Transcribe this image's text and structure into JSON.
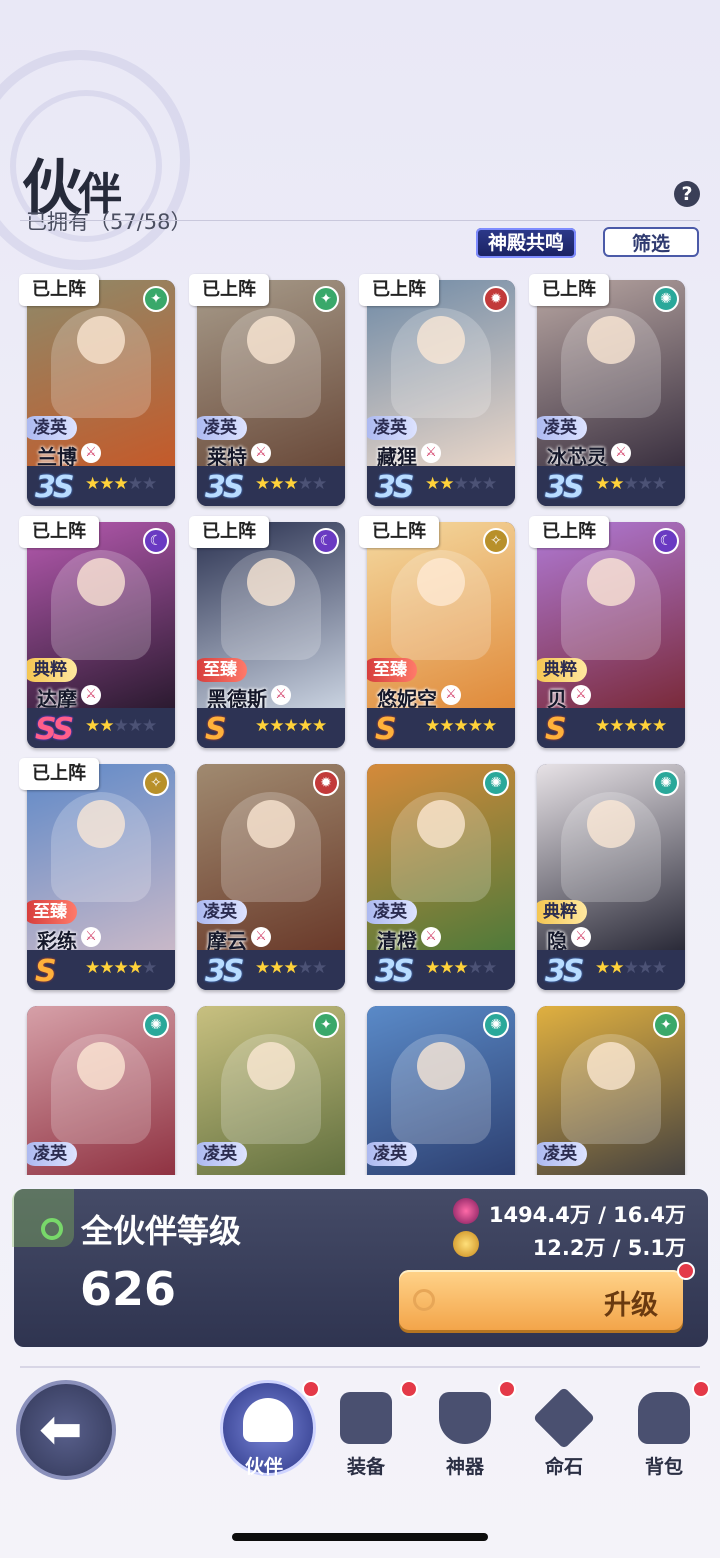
{
  "header": {
    "title_big": "伙",
    "title_small": "伴",
    "owned": "已拥有（57/58）",
    "help_icon": "?",
    "resonance_label": "神殿共鸣",
    "filter_label": "筛选"
  },
  "deployed_label": "已上阵",
  "cards": [
    {
      "name": "兰博",
      "rank": "凌英",
      "rank_type": "r1",
      "tier": "3S",
      "tier_type": "s3",
      "stars": 3,
      "deployed": true,
      "element": "green",
      "art": [
        "#8e8a6a",
        "#c45a2a"
      ]
    },
    {
      "name": "莱特",
      "rank": "凌英",
      "rank_type": "r1",
      "tier": "3S",
      "tier_type": "s3",
      "stars": 3,
      "deployed": true,
      "element": "green",
      "art": [
        "#a79b8a",
        "#6a4a3a"
      ]
    },
    {
      "name": "藏狸",
      "rank": "凌英",
      "rank_type": "r1",
      "tier": "3S",
      "tier_type": "s3",
      "stars": 2,
      "deployed": true,
      "element": "red",
      "art": [
        "#6f8aa6",
        "#e9d6c8"
      ]
    },
    {
      "name": "冰芯灵",
      "rank": "凌英",
      "rank_type": "r1",
      "tier": "3S",
      "tier_type": "s3",
      "stars": 2,
      "deployed": true,
      "element": "teal",
      "art": [
        "#b8a6a2",
        "#3a3040"
      ]
    },
    {
      "name": "达摩",
      "rank": "典粹",
      "rank_type": "r2",
      "tier": "SS",
      "tier_type": "s2",
      "stars": 2,
      "deployed": true,
      "element": "purple",
      "art": [
        "#b65ab0",
        "#2b1a30"
      ]
    },
    {
      "name": "黑德斯",
      "rank": "至臻",
      "rank_type": "r3",
      "tier": "S",
      "tier_type": "s1",
      "stars": 5,
      "deployed": true,
      "element": "purple",
      "art": [
        "#2a3150",
        "#c9d2e0"
      ]
    },
    {
      "name": "悠妮空",
      "rank": "至臻",
      "rank_type": "r3",
      "tier": "S",
      "tier_type": "s1",
      "stars": 5,
      "deployed": true,
      "element": "gold",
      "art": [
        "#f4d9a0",
        "#e08a3a"
      ]
    },
    {
      "name": "贝",
      "rank": "典粹",
      "rank_type": "r2",
      "tier": "S",
      "tier_type": "s1",
      "stars": 5,
      "deployed": true,
      "element": "purple",
      "art": [
        "#b07ad6",
        "#7a2a3a"
      ]
    },
    {
      "name": "彩练",
      "rank": "至臻",
      "rank_type": "r3",
      "tier": "S",
      "tier_type": "s1",
      "stars": 4,
      "deployed": true,
      "element": "gold",
      "art": [
        "#5f89c8",
        "#c8b8c8"
      ]
    },
    {
      "name": "摩云",
      "rank": "凌英",
      "rank_type": "r1",
      "tier": "3S",
      "tier_type": "s3",
      "stars": 3,
      "deployed": false,
      "element": "red",
      "art": [
        "#a08a70",
        "#6a3a2a"
      ]
    },
    {
      "name": "清橙",
      "rank": "凌英",
      "rank_type": "r1",
      "tier": "3S",
      "tier_type": "s3",
      "stars": 3,
      "deployed": false,
      "element": "teal",
      "art": [
        "#d58a3a",
        "#4f7a3a"
      ]
    },
    {
      "name": "隐",
      "rank": "典粹",
      "rank_type": "r2",
      "tier": "3S",
      "tier_type": "s3",
      "stars": 2,
      "deployed": false,
      "element": "teal",
      "art": [
        "#e7e2e6",
        "#2a2a38"
      ]
    },
    {
      "name": "",
      "rank": "凌英",
      "rank_type": "r1",
      "tier": "",
      "tier_type": "s3",
      "stars": 0,
      "deployed": false,
      "element": "teal",
      "art": [
        "#d6a0a8",
        "#8a2a3a"
      ]
    },
    {
      "name": "",
      "rank": "凌英",
      "rank_type": "r1",
      "tier": "",
      "tier_type": "s3",
      "stars": 0,
      "deployed": false,
      "element": "green",
      "art": [
        "#c8c080",
        "#5a6a3a"
      ]
    },
    {
      "name": "",
      "rank": "凌英",
      "rank_type": "r1",
      "tier": "",
      "tier_type": "s3",
      "stars": 0,
      "deployed": false,
      "element": "teal",
      "art": [
        "#5a8ac8",
        "#2a3a6a"
      ]
    },
    {
      "name": "",
      "rank": "凌英",
      "rank_type": "r1",
      "tier": "",
      "tier_type": "s3",
      "stars": 0,
      "deployed": false,
      "element": "green",
      "art": [
        "#e0b040",
        "#3a3a40"
      ]
    }
  ],
  "element_colors": {
    "green": "#3aa86a",
    "red": "#c23a3a",
    "teal": "#2aa89a",
    "purple": "#6a3ac2",
    "gold": "#b8902a"
  },
  "panel": {
    "title": "全伙伴等级",
    "level": "626",
    "resource1": "1494.4万 / 16.4万",
    "resource2": "12.2万 / 5.1万",
    "upgrade_label": "升级"
  },
  "nav": {
    "back_icon": "arrow-left-icon",
    "items": [
      {
        "label": "伙伴",
        "icon": "helmet-icon",
        "active": true
      },
      {
        "label": "装备",
        "icon": "vest-icon",
        "active": false
      },
      {
        "label": "神器",
        "icon": "shield-icon",
        "active": false
      },
      {
        "label": "命石",
        "icon": "crystal-icon",
        "active": false
      },
      {
        "label": "背包",
        "icon": "backpack-icon",
        "active": false
      }
    ]
  }
}
